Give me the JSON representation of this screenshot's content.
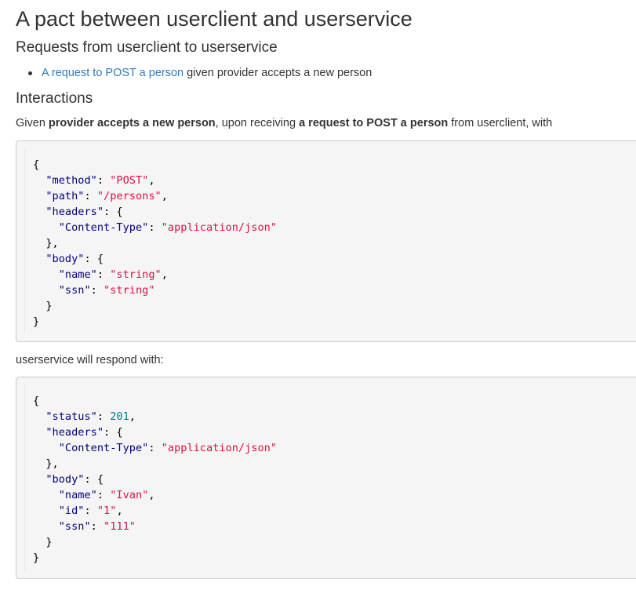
{
  "page": {
    "title": "A pact between userclient and userservice",
    "requests_heading": "Requests from userclient to userservice",
    "requests": [
      {
        "link_text": "A request to POST a person",
        "suffix": " given provider accepts a new person"
      }
    ],
    "interactions_heading": "Interactions",
    "given_sentence": {
      "part1": "Given ",
      "state": "provider accepts a new person",
      "part2": ", upon receiving ",
      "description": "a request to POST a person",
      "part3": " from userclient, with"
    },
    "respond_text": "userservice will respond with:"
  },
  "request": {
    "method_key": "\"method\"",
    "method": "\"POST\"",
    "path_key": "\"path\"",
    "path": "\"/persons\"",
    "headers_key": "\"headers\"",
    "content_type_key": "\"Content-Type\"",
    "content_type": "\"application/json\"",
    "body_key": "\"body\"",
    "name_key": "\"name\"",
    "name": "\"string\"",
    "ssn_key": "\"ssn\"",
    "ssn": "\"string\""
  },
  "response": {
    "status_key": "\"status\"",
    "status": "201",
    "headers_key": "\"headers\"",
    "content_type_key": "\"Content-Type\"",
    "content_type": "\"application/json\"",
    "body_key": "\"body\"",
    "name_key": "\"name\"",
    "name": "\"Ivan\"",
    "id_key": "\"id\"",
    "id": "\"1\"",
    "ssn_key": "\"ssn\"",
    "ssn": "\"111\""
  },
  "colors": {
    "link": "#337ab7",
    "json_key": "#000080",
    "json_string": "#dd1144",
    "json_number": "#008080",
    "code_background": "#f5f5f5"
  }
}
